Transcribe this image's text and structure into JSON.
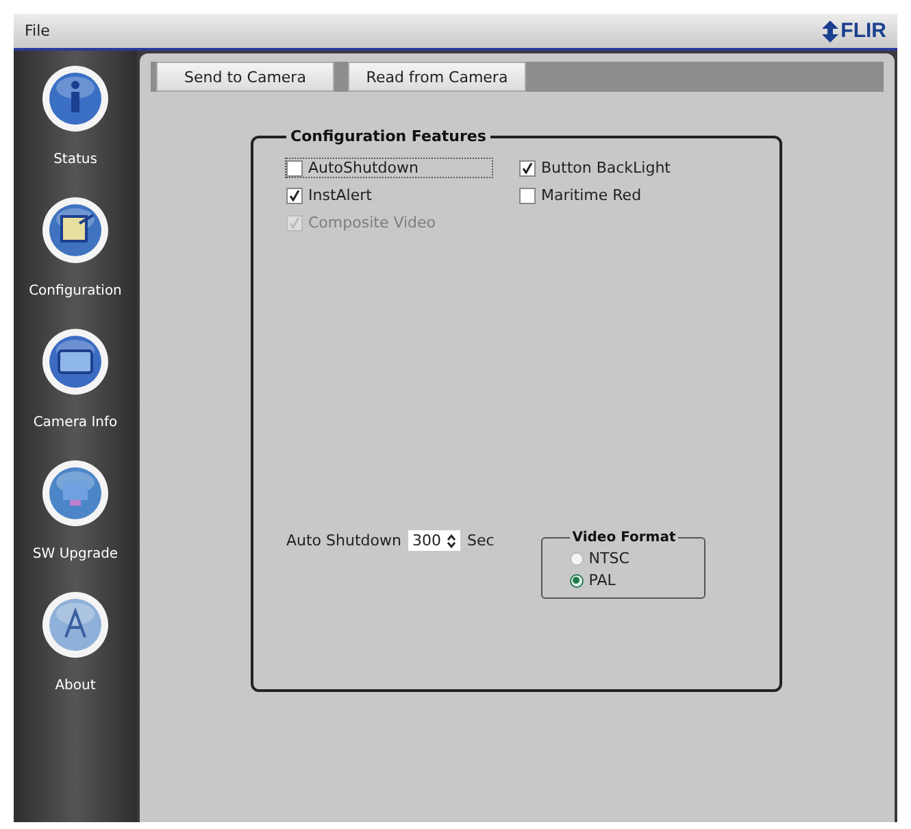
{
  "menu": [
    "File"
  ],
  "logo": "FLIR",
  "sidebar": {
    "items": [
      {
        "label": "Status"
      },
      {
        "label": "Configuration"
      },
      {
        "label": "Camera Info"
      },
      {
        "label": "SW Upgrade"
      },
      {
        "label": "About"
      }
    ]
  },
  "toolbar": [
    "Send to Camera",
    "Read from Camera"
  ],
  "group": {
    "title": "Configuration Features",
    "checkboxes": [
      {
        "label": "AutoShutdown",
        "checked": false,
        "disabled": false,
        "focused": true
      },
      {
        "label": "Button BackLight",
        "checked": true,
        "disabled": false,
        "focused": false
      },
      {
        "label": "InstAlert",
        "checked": true,
        "disabled": false,
        "focused": false
      },
      {
        "label": "Maritime Red",
        "checked": false,
        "disabled": false,
        "focused": false
      },
      {
        "label": "Composite Video",
        "checked": true,
        "disabled": true,
        "focused": false
      }
    ],
    "auto_shutdown": {
      "label": "Auto Shutdown",
      "value": "300",
      "unit": "Sec"
    },
    "video_format": {
      "title": "Video Format",
      "options": [
        {
          "label": "NTSC",
          "selected": false
        },
        {
          "label": "PAL",
          "selected": true
        }
      ]
    }
  }
}
